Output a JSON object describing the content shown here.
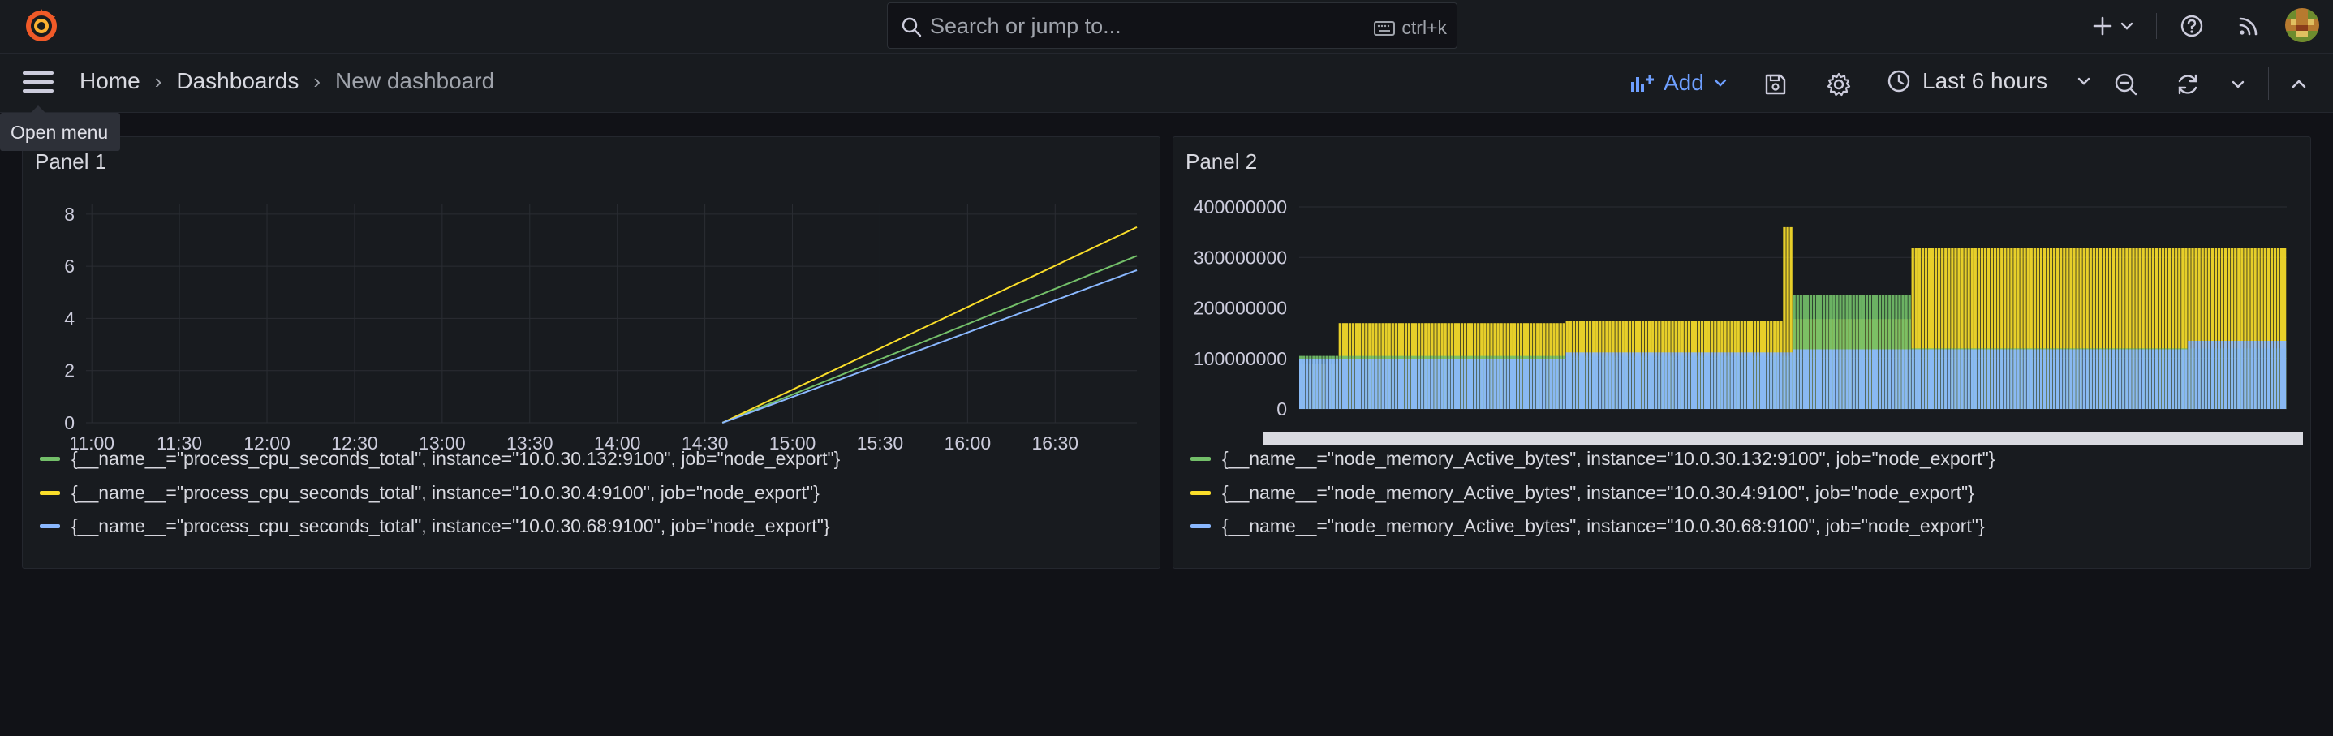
{
  "app": {
    "search_placeholder": "Search or jump to...",
    "search_shortcut": "ctrl+k",
    "colors": {
      "accent": "#6e9fff",
      "green": "#73bf69",
      "yellow": "#fade2a",
      "blue": "#8ab8ff",
      "logo": "#f05a28"
    }
  },
  "topbar_icons": [
    "plus-icon",
    "help-icon",
    "news-feed-icon",
    "user-avatar"
  ],
  "nav": {
    "menu_tooltip": "Open menu",
    "breadcrumb": [
      "Home",
      "Dashboards",
      "New dashboard"
    ],
    "add_label": "Add",
    "time_range": "Last 6 hours"
  },
  "panels": [
    {
      "title": "Panel 1",
      "legend": [
        "{__name__=\"process_cpu_seconds_total\", instance=\"10.0.30.132:9100\", job=\"node_export\"}",
        "{__name__=\"process_cpu_seconds_total\", instance=\"10.0.30.4:9100\", job=\"node_export\"}",
        "{__name__=\"process_cpu_seconds_total\", instance=\"10.0.30.68:9100\", job=\"node_export\"}"
      ]
    },
    {
      "title": "Panel 2",
      "legend": [
        "{__name__=\"node_memory_Active_bytes\", instance=\"10.0.30.132:9100\", job=\"node_export\"}",
        "{__name__=\"node_memory_Active_bytes\", instance=\"10.0.30.4:9100\", job=\"node_export\"}",
        "{__name__=\"node_memory_Active_bytes\", instance=\"10.0.30.68:9100\", job=\"node_export\"}"
      ]
    }
  ],
  "chart_data": [
    {
      "type": "line",
      "x_ticks": [
        "11:00",
        "11:30",
        "12:00",
        "12:30",
        "13:00",
        "13:30",
        "14:00",
        "14:30",
        "15:00",
        "15:30",
        "16:00",
        "16:30"
      ],
      "y_ticks": [
        0,
        2,
        4,
        6,
        8
      ],
      "ylim": [
        0,
        8.4
      ],
      "x_range": [
        "10:58",
        "16:58"
      ],
      "series": [
        {
          "name": "{__name__=\"process_cpu_seconds_total\", instance=\"10.0.30.132:9100\", job=\"node_export\"}",
          "color": "#73bf69",
          "x": [
            "14:36",
            "16:58"
          ],
          "values": [
            0,
            6.4
          ]
        },
        {
          "name": "{__name__=\"process_cpu_seconds_total\", instance=\"10.0.30.4:9100\", job=\"node_export\"}",
          "color": "#fade2a",
          "x": [
            "14:36",
            "16:58"
          ],
          "values": [
            0,
            7.5
          ]
        },
        {
          "name": "{__name__=\"process_cpu_seconds_total\", instance=\"10.0.30.68:9100\", job=\"node_export\"}",
          "color": "#8ab8ff",
          "x": [
            "14:36",
            "16:58"
          ],
          "values": [
            0,
            5.85
          ]
        }
      ],
      "grid": true,
      "legend_placement": "bottom"
    },
    {
      "type": "bar",
      "y_ticks": [
        0,
        100000000,
        200000000,
        300000000,
        400000000
      ],
      "y_tick_labels": [
        "0",
        "100000000",
        "200000000",
        "300000000",
        "400000000"
      ],
      "ylim": [
        0,
        400000000
      ],
      "bar_count": 300,
      "series": [
        {
          "name": "{__name__=\"node_memory_Active_bytes\", instance=\"10.0.30.132:9100\", job=\"node_export\"}",
          "color": "#73bf69",
          "segments": [
            {
              "from": 0,
              "to": 0.1,
              "value": 105000000
            },
            {
              "from": 0.1,
              "to": 0.5,
              "value": 105000000
            },
            {
              "from": 0.5,
              "to": 0.62,
              "value": 225000000
            },
            {
              "from": 0.62,
              "to": 1.0,
              "value": 120000000
            }
          ]
        },
        {
          "name": "{__name__=\"node_memory_Active_bytes\", instance=\"10.0.30.4:9100\", job=\"node_export\"}",
          "color": "#fade2a",
          "segments": [
            {
              "from": 0,
              "to": 0.04,
              "value": 90000000
            },
            {
              "from": 0.04,
              "to": 0.27,
              "value": 170000000
            },
            {
              "from": 0.27,
              "to": 0.5,
              "value": 175000000
            },
            {
              "from": 0.5,
              "to": 0.62,
              "value": 178000000
            },
            {
              "from": 0.62,
              "to": 1.0,
              "value": 318000000
            }
          ]
        },
        {
          "name": "{__name__=\"node_memory_Active_bytes\", instance=\"10.0.30.68:9100\", job=\"node_export\"}",
          "color": "#8ab8ff",
          "segments": [
            {
              "from": 0,
              "to": 0.27,
              "value": 98000000
            },
            {
              "from": 0.27,
              "to": 0.5,
              "value": 112000000
            },
            {
              "from": 0.5,
              "to": 0.9,
              "value": 118000000
            },
            {
              "from": 0.9,
              "to": 1.0,
              "value": 135000000
            }
          ]
        }
      ],
      "spike_value": 360000000,
      "grid": true,
      "legend_placement": "bottom"
    }
  ]
}
